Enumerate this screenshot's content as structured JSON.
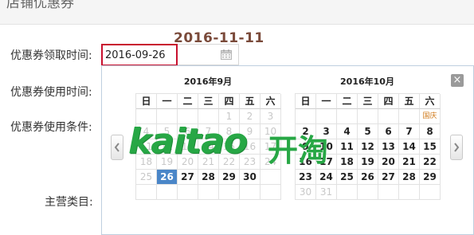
{
  "header": {
    "title": "店铺优惠券"
  },
  "highlight_date": "2016-11-11",
  "form": {
    "coupon_claim_time_label": "优惠券领取时间:",
    "coupon_use_time_label": "优惠券使用时间:",
    "coupon_use_condition_label": "优惠券使用条件:",
    "main_category_label": "主营类目:",
    "date_value": "2016-09-26"
  },
  "picker": {
    "close_symbol": "×",
    "weekdays": [
      "日",
      "一",
      "二",
      "三",
      "四",
      "五",
      "六"
    ],
    "months": [
      {
        "title": "2016年9月",
        "rows": [
          [
            {
              "t": "",
              "s": "empty"
            },
            {
              "t": "",
              "s": "empty"
            },
            {
              "t": "",
              "s": "empty"
            },
            {
              "t": "",
              "s": "empty"
            },
            {
              "t": "1",
              "s": "dim"
            },
            {
              "t": "2",
              "s": "dim"
            },
            {
              "t": "3",
              "s": "dim"
            }
          ],
          [
            {
              "t": "4",
              "s": "dim"
            },
            {
              "t": "5",
              "s": "dim"
            },
            {
              "t": "6",
              "s": "dim"
            },
            {
              "t": "7",
              "s": "dim"
            },
            {
              "t": "8",
              "s": "dim"
            },
            {
              "t": "9",
              "s": "dim"
            },
            {
              "t": "10",
              "s": "dim"
            }
          ],
          [
            {
              "t": "11",
              "s": "dim"
            },
            {
              "t": "12",
              "s": "dim"
            },
            {
              "t": "13",
              "s": "dim"
            },
            {
              "t": "14",
              "s": "dim"
            },
            {
              "t": "15",
              "s": "dim"
            },
            {
              "t": "16",
              "s": "dim"
            },
            {
              "t": "17",
              "s": "dim"
            }
          ],
          [
            {
              "t": "18",
              "s": "dim"
            },
            {
              "t": "19",
              "s": "dim"
            },
            {
              "t": "20",
              "s": "dim"
            },
            {
              "t": "21",
              "s": "dim"
            },
            {
              "t": "22",
              "s": "dim"
            },
            {
              "t": "23",
              "s": "dim"
            },
            {
              "t": "24",
              "s": "dim"
            }
          ],
          [
            {
              "t": "25",
              "s": "dim"
            },
            {
              "t": "26",
              "s": "sel"
            },
            {
              "t": "27",
              "s": ""
            },
            {
              "t": "28",
              "s": ""
            },
            {
              "t": "29",
              "s": ""
            },
            {
              "t": "30",
              "s": ""
            },
            {
              "t": "",
              "s": "empty"
            }
          ],
          [
            {
              "t": "",
              "s": "empty"
            },
            {
              "t": "",
              "s": "empty"
            },
            {
              "t": "",
              "s": "empty"
            },
            {
              "t": "",
              "s": "empty"
            },
            {
              "t": "",
              "s": "empty"
            },
            {
              "t": "",
              "s": "empty"
            },
            {
              "t": "",
              "s": "empty"
            }
          ]
        ]
      },
      {
        "title": "2016年10月",
        "rows": [
          [
            {
              "t": "",
              "s": "empty"
            },
            {
              "t": "",
              "s": "empty"
            },
            {
              "t": "",
              "s": "empty"
            },
            {
              "t": "",
              "s": "empty"
            },
            {
              "t": "",
              "s": "empty"
            },
            {
              "t": "",
              "s": "empty"
            },
            {
              "t": "国庆",
              "s": "holiday"
            }
          ],
          [
            {
              "t": "2",
              "s": ""
            },
            {
              "t": "3",
              "s": ""
            },
            {
              "t": "4",
              "s": ""
            },
            {
              "t": "5",
              "s": ""
            },
            {
              "t": "6",
              "s": ""
            },
            {
              "t": "7",
              "s": ""
            },
            {
              "t": "8",
              "s": ""
            }
          ],
          [
            {
              "t": "9",
              "s": ""
            },
            {
              "t": "10",
              "s": ""
            },
            {
              "t": "11",
              "s": ""
            },
            {
              "t": "12",
              "s": ""
            },
            {
              "t": "13",
              "s": ""
            },
            {
              "t": "14",
              "s": ""
            },
            {
              "t": "15",
              "s": ""
            }
          ],
          [
            {
              "t": "16",
              "s": ""
            },
            {
              "t": "17",
              "s": ""
            },
            {
              "t": "18",
              "s": ""
            },
            {
              "t": "19",
              "s": ""
            },
            {
              "t": "20",
              "s": ""
            },
            {
              "t": "21",
              "s": ""
            },
            {
              "t": "22",
              "s": ""
            }
          ],
          [
            {
              "t": "23",
              "s": ""
            },
            {
              "t": "24",
              "s": ""
            },
            {
              "t": "25",
              "s": ""
            },
            {
              "t": "26",
              "s": ""
            },
            {
              "t": "27",
              "s": ""
            },
            {
              "t": "28",
              "s": ""
            },
            {
              "t": "29",
              "s": ""
            }
          ],
          [
            {
              "t": "30",
              "s": "dim"
            },
            {
              "t": "31",
              "s": "dim"
            },
            {
              "t": "",
              "s": "empty"
            },
            {
              "t": "",
              "s": "empty"
            },
            {
              "t": "",
              "s": "empty"
            },
            {
              "t": "",
              "s": "empty"
            },
            {
              "t": "",
              "s": "empty"
            }
          ]
        ]
      }
    ]
  },
  "watermark": {
    "text": "kaitao",
    "cn": "开淘"
  },
  "colors": {
    "selected": "#4a86c8",
    "input_border_highlight": "#c8102e",
    "holiday": "#d07a1a",
    "date_title": "#7a4a3a",
    "watermark": "#27a745"
  },
  "icons": {
    "calendar": "calendar-icon",
    "close": "close-icon",
    "prev": "chevron-left-icon",
    "next": "chevron-right-icon"
  }
}
